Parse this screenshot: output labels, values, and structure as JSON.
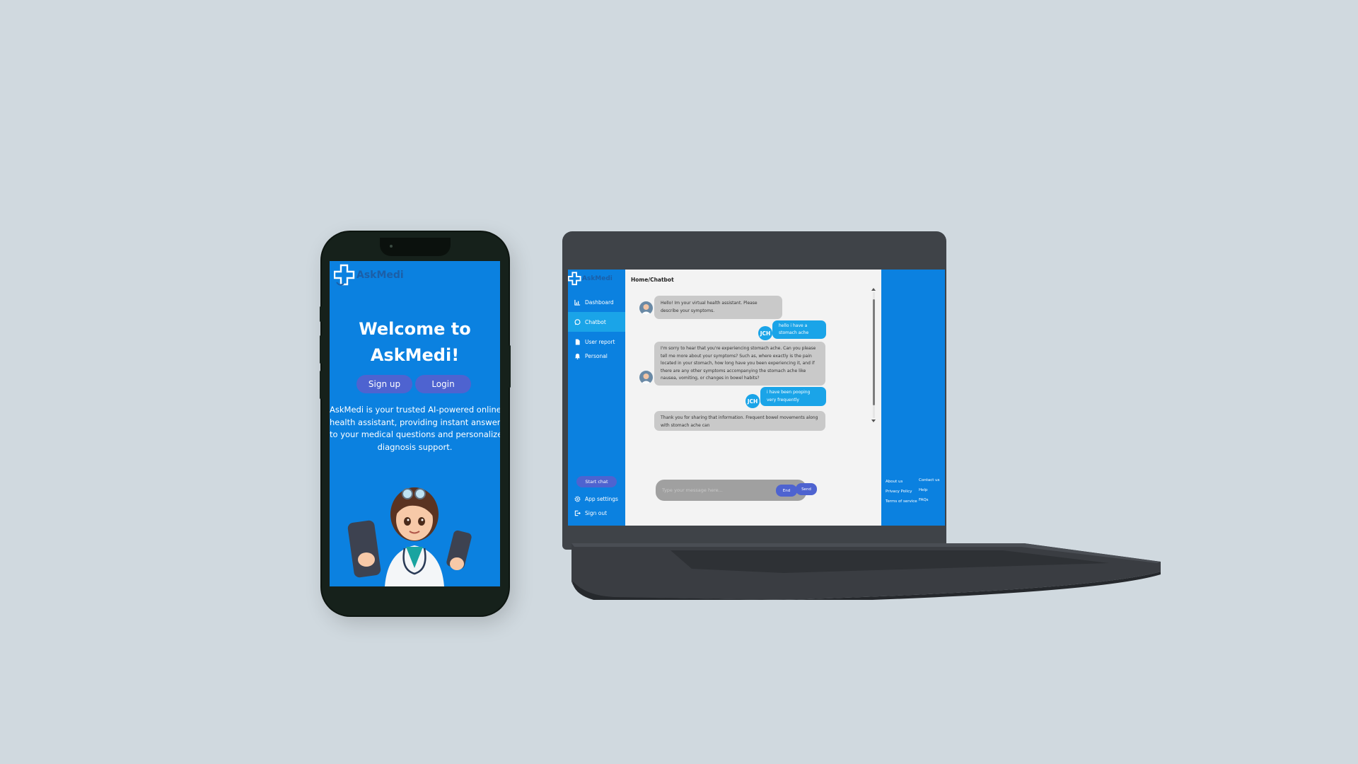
{
  "phone": {
    "logo_text": "AskMedi",
    "welcome_line1": "Welcome to",
    "welcome_line2": "AskMedi!",
    "signup_label": "Sign up",
    "login_label": "Login",
    "description": [
      "AskMedi is your trusted AI-powered online",
      "health assistant, providing instant answers",
      "to your medical questions and personalized",
      "diagnosis support."
    ]
  },
  "laptop": {
    "logo_text": "AskMedi",
    "breadcrumb": "Home/Chatbot",
    "sidebar": {
      "items": [
        {
          "label": "Dashboard",
          "icon": "bar-chart-icon"
        },
        {
          "label": "Chatbot",
          "icon": "chat-bubble-icon",
          "active": true
        },
        {
          "label": "User report",
          "icon": "document-icon"
        },
        {
          "label": "Personal",
          "icon": "bell-icon"
        }
      ],
      "start_chat": "Start chat",
      "app_settings": "App settings",
      "sign_out": "Sign out"
    },
    "chat": {
      "messages": [
        {
          "from": "bot",
          "text": "Hello! Im your virtual health assistant. Please describe your symptoms."
        },
        {
          "from": "user",
          "text": "hello i have a stomach ache",
          "initials": "JCH"
        },
        {
          "from": "bot",
          "text": "I'm sorry to hear that you're experiencing stomach ache. Can you please tell me more about your symptoms? Such as, where exactly is the pain located in your stomach, how long have you been experiencing it, and if there are any other symptoms accompanying the stomach ache like nausea, vomiting, or changes in bowel habits?"
        },
        {
          "from": "user",
          "text": "i have been pooping very frequently",
          "initials": "JCH"
        },
        {
          "from": "bot",
          "text": "Thank you for sharing that information. Frequent bowel movements along with stomach ache can"
        }
      ],
      "input_placeholder": "Type your message here...",
      "end_label": "End",
      "send_label": "Send"
    },
    "footer_links": {
      "about": "About us",
      "contact": "Contact us",
      "privacy": "Privacy Policy",
      "help": "Help",
      "terms": "Terms of service",
      "faqs": "FAQs"
    }
  },
  "colors": {
    "background": "#d0d9df",
    "brand_blue": "#0b81e0",
    "button_indigo": "#4e63d0",
    "active_cyan": "#1aa4e8"
  }
}
